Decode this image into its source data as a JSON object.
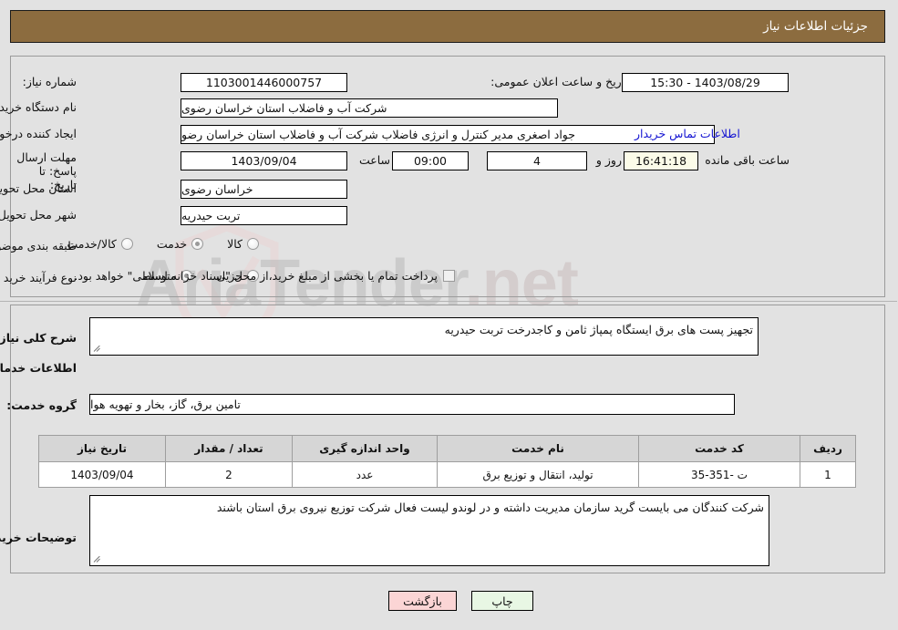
{
  "header": {
    "title": "جزئیات اطلاعات نیاز"
  },
  "watermark": {
    "text": "AriaTender",
    "tld": ".net"
  },
  "fields": {
    "need_number_label": "شماره نیاز:",
    "need_number_value": "1103001446000757",
    "announce_datetime_label": "تاریخ و ساعت اعلان عمومی:",
    "announce_datetime_value": "1403/08/29 - 15:30",
    "buyer_org_label": "نام دستگاه خریدار:",
    "buyer_org_value": "شرکت آب و فاضلاب استان خراسان رضوی",
    "requester_label": "ایجاد کننده درخواست:",
    "requester_value": "جواد اصغری مدیر کنترل و انرژی فاضلاب شرکت آب و فاضلاب استان خراسان رضو",
    "contact_link": "اطلاعات تماس خریدار",
    "deadline_label": "مهلت ارسال پاسخ: تا تاریخ:",
    "deadline_date": "1403/09/04",
    "deadline_time_label": "ساعت",
    "deadline_time": "09:00",
    "remaining_days": "4",
    "remaining_days_label": "روز و",
    "remaining_clock": "16:41:18",
    "remaining_clock_label": "ساعت باقی مانده",
    "province_label": "استان محل تحویل:",
    "province_value": "خراسان رضوی",
    "city_label": "شهر محل تحویل:",
    "city_value": "تربت حیدریه",
    "category_label": "طبقه بندی موضوعی:",
    "purchase_type_label": "نوع فرآیند خرید :",
    "treasury_note": "پرداخت تمام یا بخشی از مبلغ خرید،از محل \"اسناد خزانه اسلامی\" خواهد بود."
  },
  "category_options": [
    {
      "label": "کالا",
      "checked": false
    },
    {
      "label": "خدمت",
      "checked": true
    },
    {
      "label": "کالا/خدمت",
      "checked": false
    }
  ],
  "purchase_options": [
    {
      "label": "جزیی",
      "checked": false
    },
    {
      "label": "متوسط",
      "checked": true
    }
  ],
  "description": {
    "label": "شرح کلی نیاز:",
    "value": "تجهیز پست های برق ایستگاه پمپاژ ثامن و کاجدرخت تربت حیدریه"
  },
  "services_section": {
    "heading": "اطلاعات خدمات مورد نیاز",
    "group_label": "گروه خدمت:",
    "group_value": "تامین برق، گاز، بخار و تهویه هوا"
  },
  "table": {
    "columns": [
      "ردیف",
      "کد خدمت",
      "نام خدمت",
      "واحد اندازه گیری",
      "تعداد / مقدار",
      "تاریخ نیاز"
    ],
    "rows": [
      {
        "row_no": "1",
        "service_code": "ت -351-35",
        "service_name": "تولید، انتقال و توزیع برق",
        "unit": "عدد",
        "quantity": "2",
        "need_date": "1403/09/04"
      }
    ]
  },
  "buyer_notes": {
    "label": "توضیحات خریدار:",
    "value": "شرکت کنندگان می بایست گرید سازمان مدیریت داشته و در لوندو لیست فعال شرکت توزیع نیروی برق استان باشند"
  },
  "buttons": {
    "print": "چاپ",
    "back": "بازگشت"
  },
  "colors": {
    "header_bar": "#8c6c3f",
    "page_background": "#e2e2e2",
    "link": "#1414d2",
    "print_button": "#e8f7e4",
    "back_button": "#fbd5d5",
    "timer_field": "#fbfbe8"
  }
}
